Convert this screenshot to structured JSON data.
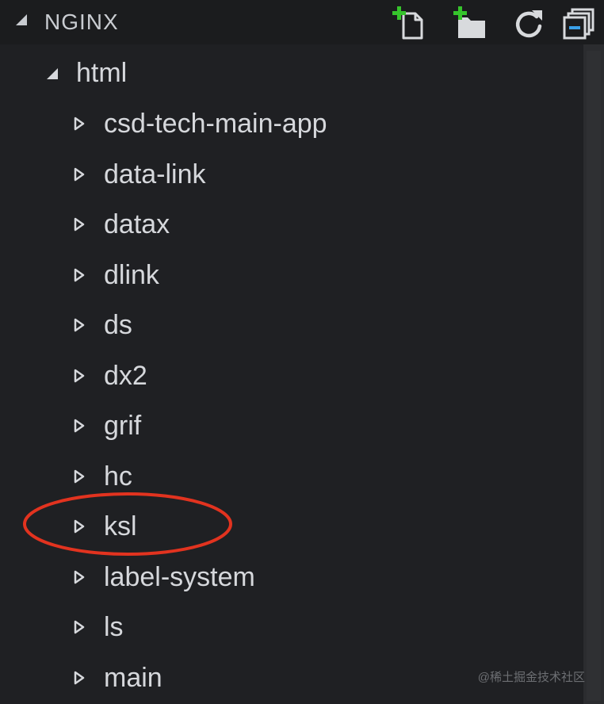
{
  "explorer": {
    "section_title": "NGINX",
    "actions": [
      {
        "name": "new-file-icon"
      },
      {
        "name": "new-folder-icon"
      },
      {
        "name": "refresh-icon"
      },
      {
        "name": "collapse-all-icon"
      }
    ],
    "root_folder": {
      "label": "html",
      "expanded": true
    },
    "children": [
      {
        "label": "csd-tech-main-app"
      },
      {
        "label": "data-link"
      },
      {
        "label": "datax"
      },
      {
        "label": "dlink"
      },
      {
        "label": "ds"
      },
      {
        "label": "dx2"
      },
      {
        "label": "grif"
      },
      {
        "label": "hc"
      },
      {
        "label": "ksl",
        "annotated": true
      },
      {
        "label": "label-system"
      },
      {
        "label": "ls"
      },
      {
        "label": "main"
      }
    ]
  },
  "annotation": {
    "color": "#e2331f",
    "target": "ksl"
  },
  "watermark": "@稀土掘金技术社区",
  "colors": {
    "background": "#1f2023",
    "header": "#1b1c1e",
    "text": "#d6d8dc",
    "icon_green": "#36c42c"
  }
}
